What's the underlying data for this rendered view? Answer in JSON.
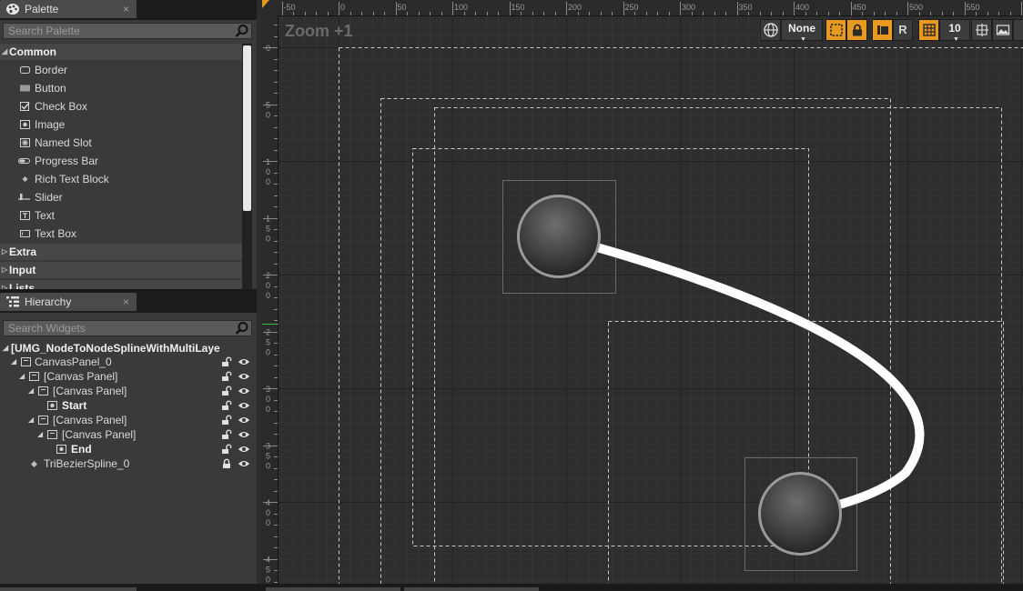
{
  "palette": {
    "tab_title": "Palette",
    "close_glyph": "×",
    "search_placeholder": "Search Palette",
    "category_common": "Common",
    "items": [
      {
        "label": "Border",
        "icon": "border-icon"
      },
      {
        "label": "Button",
        "icon": "button-icon"
      },
      {
        "label": "Check Box",
        "icon": "checkbox-icon"
      },
      {
        "label": "Image",
        "icon": "image-icon"
      },
      {
        "label": "Named Slot",
        "icon": "named-slot-icon"
      },
      {
        "label": "Progress Bar",
        "icon": "progress-bar-icon"
      },
      {
        "label": "Rich Text Block",
        "icon": "rich-text-icon"
      },
      {
        "label": "Slider",
        "icon": "slider-icon"
      },
      {
        "label": "Text",
        "icon": "text-icon"
      },
      {
        "label": "Text Box",
        "icon": "text-box-icon"
      }
    ],
    "categories_collapsed": [
      "Extra",
      "Input",
      "Lists"
    ]
  },
  "hierarchy": {
    "tab_title": "Hierarchy",
    "close_glyph": "×",
    "search_placeholder": "Search Widgets",
    "root_label": "[UMG_NodeToNodeSplineWithMultiLaye",
    "rows": [
      {
        "label": "CanvasPanel_0",
        "bold": false
      },
      {
        "label": "[Canvas Panel]",
        "bold": false
      },
      {
        "label": "[Canvas Panel]",
        "bold": false
      },
      {
        "label": "Start",
        "bold": true
      },
      {
        "label": "[Canvas Panel]",
        "bold": false
      },
      {
        "label": "[Canvas Panel]",
        "bold": false
      },
      {
        "label": "End",
        "bold": true
      },
      {
        "label": "TriBezierSpline_0",
        "bold": false
      }
    ]
  },
  "designer": {
    "zoom_label": "Zoom +1",
    "ruler_x_labels": [
      "-50",
      "0",
      "50",
      "100",
      "150",
      "200",
      "250",
      "300",
      "350",
      "400",
      "450",
      "500",
      "550",
      "6"
    ],
    "ruler_y_labels": [
      "0",
      "50",
      "100",
      "150",
      "200",
      "250",
      "300",
      "350",
      "400",
      "450"
    ],
    "toolbar": {
      "preview_label": "None",
      "r_label": "R",
      "grid_size_value": "10"
    },
    "accent_color": "#e79a1f"
  }
}
